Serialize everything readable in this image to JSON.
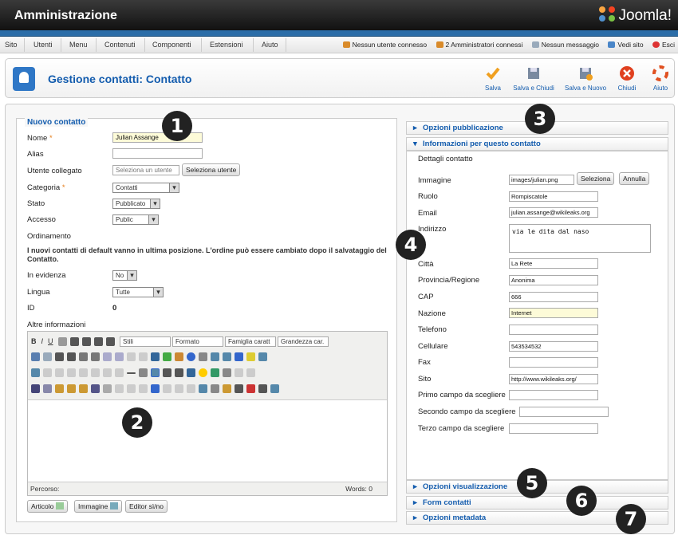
{
  "header": {
    "title": "Amministrazione",
    "logo": "Joomla!"
  },
  "menu": [
    "Sito",
    "Utenti",
    "Menu",
    "Contenuti",
    "Componenti",
    "Estensioni",
    "Aiuto"
  ],
  "status": [
    "Nessun utente connesso",
    "2 Amministratori connessi",
    "Nessun messaggio",
    "Vedi sito",
    "Esci"
  ],
  "page": {
    "title": "Gestione contatti: Contatto"
  },
  "toolbar": [
    "Salva",
    "Salva e Chiudi",
    "Salva e Nuovo",
    "Chiudi",
    "Aiuto"
  ],
  "form": {
    "legend": "Nuovo contatto",
    "nome_label": "Nome",
    "nome_value": "Julian Assange",
    "alias_label": "Alias",
    "utente_label": "Utente collegato",
    "utente_placeholder": "Seleziona un utente",
    "utente_btn": "Seleziona utente",
    "categoria_label": "Categoria",
    "categoria_value": "Contatti",
    "stato_label": "Stato",
    "stato_value": "Pubblicato",
    "accesso_label": "Accesso",
    "accesso_value": "Public",
    "ordinamento_label": "Ordinamento",
    "note": "I nuovi contatti di default vanno in ultima posizione. L'ordine può essere cambiato dopo il salvataggio del Contatto.",
    "evidenza_label": "In evidenza",
    "evidenza_value": "No",
    "lingua_label": "Lingua",
    "lingua_value": "Tutte",
    "id_label": "ID",
    "id_value": "0",
    "altre_label": "Altre informazioni",
    "stili": "Stili",
    "formato": "Formato",
    "famiglia": "Famiglia caratt",
    "grandezza": "Grandezza car.",
    "percorso": "Percorso:",
    "words": "Words: 0",
    "btn_articolo": "Articolo",
    "btn_immagine": "Immagine",
    "btn_editor": "Editor sì/no"
  },
  "panels": {
    "pubblicazione": "Opzioni pubblicazione",
    "informazioni": "Informazioni per questo contatto",
    "dettagli": "Dettagli contatto",
    "visualizzazione": "Opzioni visualizzazione",
    "form": "Form contatti",
    "metadata": "Opzioni metadata"
  },
  "details": {
    "immagine_label": "Immagine",
    "immagine_value": "images/julian.png",
    "seleziona": "Seleziona",
    "annulla": "Annulla",
    "ruolo_label": "Ruolo",
    "ruolo_value": "Rompiscatole",
    "email_label": "Email",
    "email_value": "julian.assange@wikileaks.org",
    "indirizzo_label": "Indirizzo",
    "indirizzo_value": "via le dita dal naso",
    "citta_label": "Città",
    "citta_value": "La Rete",
    "provincia_label": "Provincia/Regione",
    "provincia_value": "Anonima",
    "cap_label": "CAP",
    "cap_value": "666",
    "nazione_label": "Nazione",
    "nazione_value": "Internet",
    "telefono_label": "Telefono",
    "cellulare_label": "Cellulare",
    "cellulare_value": "543534532",
    "fax_label": "Fax",
    "sito_label": "Sito",
    "sito_value": "http://www.wikileaks.org/",
    "primo_label": "Primo campo da scegliere",
    "secondo_label": "Secondo campo da scegliere",
    "terzo_label": "Terzo campo da scegliere"
  },
  "markers": [
    "1",
    "2",
    "3",
    "4",
    "5",
    "6",
    "7"
  ]
}
